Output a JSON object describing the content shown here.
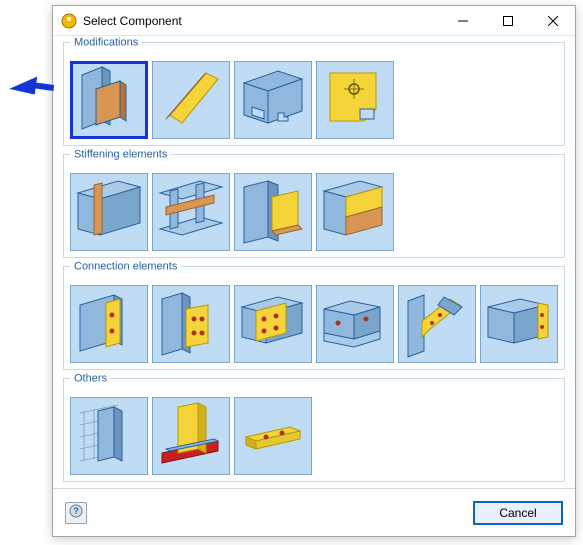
{
  "window": {
    "title": "Select Component"
  },
  "groups": {
    "modifications": {
      "title": "Modifications"
    },
    "stiffening": {
      "title": "Stiffening elements"
    },
    "connection": {
      "title": "Connection elements"
    },
    "others": {
      "title": "Others"
    }
  },
  "footer": {
    "cancel_label": "Cancel"
  }
}
